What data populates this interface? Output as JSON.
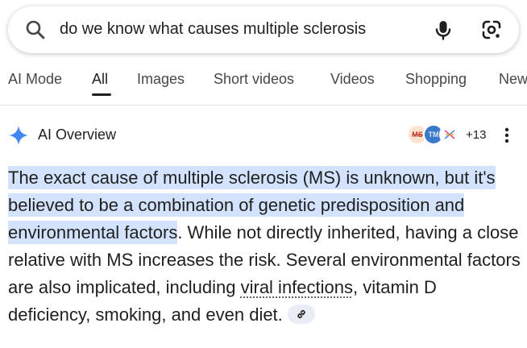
{
  "search": {
    "query": "do we know what causes multiple sclerosis",
    "icon": "search-icon",
    "mic_icon": "mic-icon",
    "lens_icon": "google-lens-icon"
  },
  "tabs": [
    {
      "label": "AI Mode",
      "active": false
    },
    {
      "label": "All",
      "active": true
    },
    {
      "label": "Images",
      "active": false
    },
    {
      "label": "Short videos",
      "active": false
    },
    {
      "label": "Videos",
      "active": false
    },
    {
      "label": "Shopping",
      "active": false
    },
    {
      "label": "News",
      "active": false
    }
  ],
  "ai_overview": {
    "title": "AI Overview",
    "sparkle_color": "#4285f4",
    "sources": [
      {
        "label": "MS",
        "color": "#fde4d0"
      },
      {
        "label": "TM",
        "color": "#3a78c9"
      },
      {
        "label": "",
        "color": "#ffffff"
      }
    ],
    "source_count": "+13",
    "answer": {
      "highlighted": "The exact cause of multiple sclerosis (MS) is unknown, but it's believed to be a combination of genetic predisposition and environmental factors",
      "text_1": ". While not directly inherited, having a close relative with MS increases the risk. Several environmental factors are also implicated, including ",
      "link": "viral infections",
      "text_2": ", vitamin D deficiency, smoking, and even diet.",
      "highlight_color": "#d3e3fd"
    }
  }
}
